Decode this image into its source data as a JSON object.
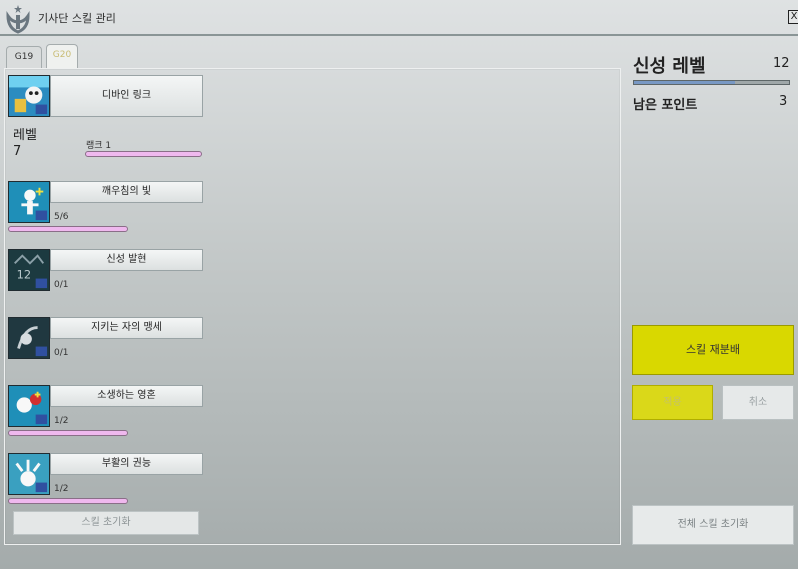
{
  "window": {
    "title": "기사단 스킬 관리",
    "close_glyph": "X"
  },
  "tabs": [
    {
      "label": "G19",
      "active": false
    },
    {
      "label": "G20",
      "active": true
    }
  ],
  "link": {
    "label": "디바인 링크"
  },
  "level": {
    "label": "레벨",
    "value": "7",
    "rank_label": "랭크 1"
  },
  "skills": [
    {
      "name": "깨우침의 빛",
      "level": "5/6",
      "icon": "light-skill-icon"
    },
    {
      "name": "신성 발현",
      "level": "0/1",
      "icon": "holy-manifest-skill-icon"
    },
    {
      "name": "지키는 자의 맹세",
      "level": "0/1",
      "icon": "guardian-oath-skill-icon"
    },
    {
      "name": "소생하는 영혼",
      "level": "1/2",
      "icon": "reviving-soul-skill-icon"
    },
    {
      "name": "부활의 권능",
      "level": "1/2",
      "icon": "resurrection-skill-icon"
    }
  ],
  "skill_reset_label": "스킬 초기화",
  "divine": {
    "label": "신성 레벨",
    "value": "12",
    "progress": 0.65
  },
  "points": {
    "label": "남은 포인트",
    "value": "3"
  },
  "buttons": {
    "redistribute": "스킬 재분배",
    "apply": "적용",
    "cancel": "취소",
    "reset_all": "전체 스킬 초기화"
  },
  "colors": {
    "accent_yellow": "#d9d800",
    "progress_blue": "#7898c4",
    "bar_pink": "#efb8ee"
  }
}
